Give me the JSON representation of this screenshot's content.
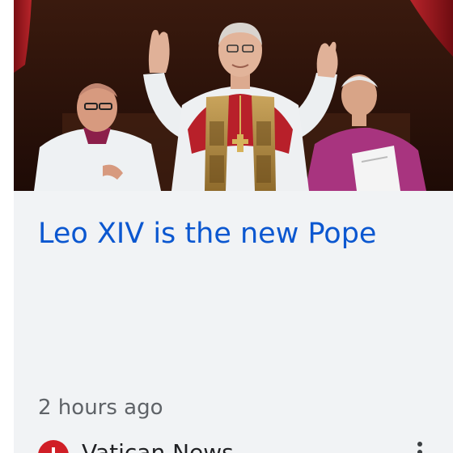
{
  "card": {
    "image": {
      "description_icon": "photo",
      "label": ""
    },
    "headline": "Leo XIV is the new Pope",
    "timestamp": "2 hours ago",
    "source": {
      "name": "Vatican News",
      "logo_icon": "vatican-news-logo"
    },
    "more_icon": "more-vert-icon"
  },
  "colors": {
    "headline": "#0b57d0",
    "card_background": "#f1f3f5",
    "timestamp": "#5f6368",
    "source_logo": "#d01f27"
  }
}
